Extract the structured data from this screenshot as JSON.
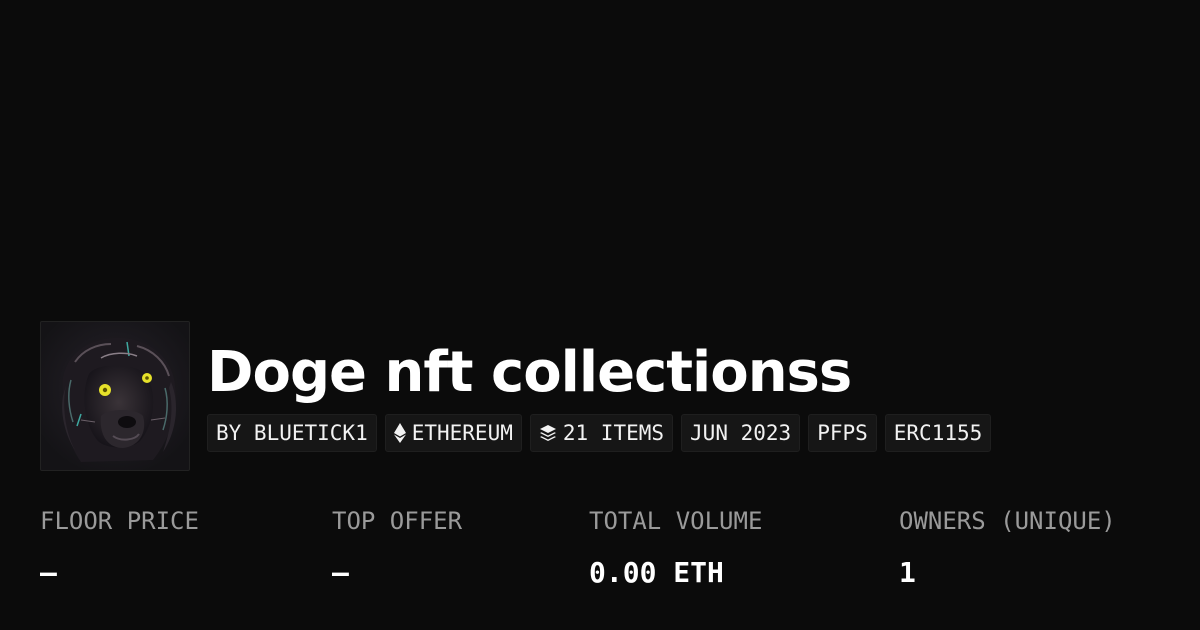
{
  "collection": {
    "title": "Doge nft collectionss",
    "avatar_icon": "dog-portrait-icon"
  },
  "chips": {
    "creator": "BY BLUETICK1",
    "chain": "ETHEREUM",
    "chain_icon": "ethereum-icon",
    "items": "21 ITEMS",
    "items_icon": "layers-icon",
    "date": "JUN 2023",
    "category": "PFPS",
    "standard": "ERC1155"
  },
  "stats": {
    "floor_price": {
      "label": "FLOOR PRICE",
      "value": "–"
    },
    "top_offer": {
      "label": "TOP OFFER",
      "value": "–"
    },
    "total_volume": {
      "label": "TOTAL VOLUME",
      "value": "0.00 ETH"
    },
    "owners": {
      "label": "OWNERS (UNIQUE)",
      "value": "1"
    }
  },
  "colors": {
    "background": "#0b0b0b",
    "chip_background": "#161616",
    "label_gray": "#9a9a9a",
    "text_white": "#ffffff",
    "eye_yellow": "#e6e12a"
  }
}
